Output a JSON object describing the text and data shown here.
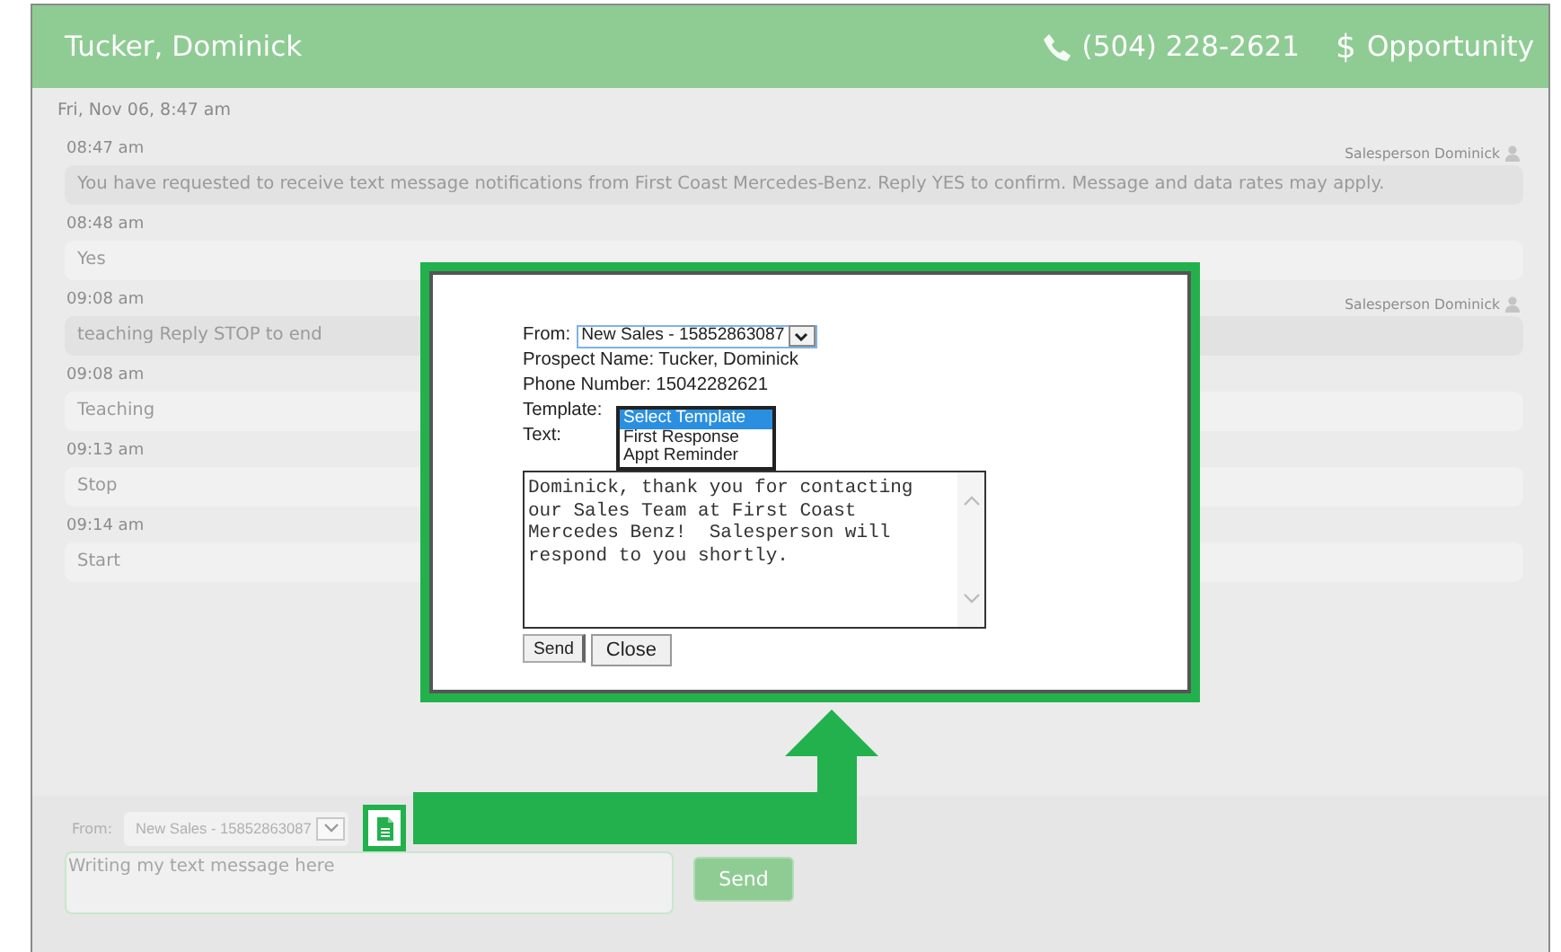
{
  "header": {
    "name": "Tucker, Dominick",
    "phone": "(504) 228-2621",
    "currency_symbol": "$",
    "status": "Opportunity"
  },
  "thread": {
    "date": "Fri, Nov 06, 8:47 am",
    "messages": [
      {
        "time": "08:47 am",
        "kind": "outgoing",
        "sender": "Salesperson Dominick",
        "text": "You have requested to receive text message notifications from First Coast Mercedes-Benz. Reply YES to confirm. Message and data rates may apply."
      },
      {
        "time": "08:48 am",
        "kind": "incoming",
        "text": "Yes"
      },
      {
        "time": "09:08 am",
        "kind": "outgoing",
        "sender": "Salesperson Dominick",
        "text": "teaching Reply STOP to end"
      },
      {
        "time": "09:08 am",
        "kind": "incoming",
        "text": "Teaching"
      },
      {
        "time": "09:13 am",
        "kind": "incoming",
        "text": "Stop"
      },
      {
        "time": "09:14 am",
        "kind": "incoming",
        "text": "Start"
      }
    ]
  },
  "dialog": {
    "from_label": "From:",
    "from_value": "New Sales - 15852863087",
    "prospect": "Prospect Name: Tucker, Dominick",
    "phone": "Phone Number: 15042282621",
    "template_label": "Template:",
    "template_options": [
      {
        "label": "Select Template",
        "selected": true
      },
      {
        "label": "First Response",
        "selected": false
      },
      {
        "label": "Appt Reminder",
        "selected": false
      }
    ],
    "text_label": "Text:",
    "text_value": "Dominick, thank you for contacting\nour Sales Team at First Coast\nMercedes Benz!  Salesperson will\nrespond to you shortly.",
    "buttons": [
      "Send",
      "Close"
    ]
  },
  "composer": {
    "from_label": "From:",
    "from_value": "New Sales - 15852863087",
    "placeholder": "Writing my text message here",
    "send": "Send"
  }
}
